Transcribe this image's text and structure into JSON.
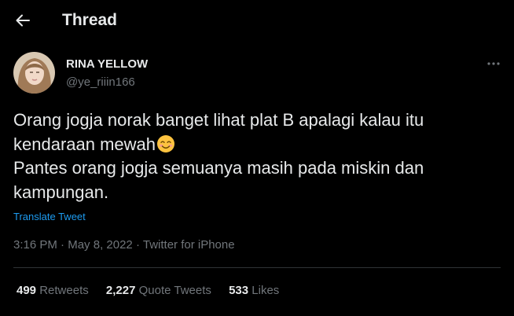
{
  "header": {
    "title": "Thread",
    "back_icon": "arrow-left-icon"
  },
  "tweet": {
    "author": {
      "display_name": "RINA YELLOW",
      "handle": "@ye_riiin166"
    },
    "more_icon": "more-horizontal-icon",
    "text_lines": [
      "Orang jogja norak banget lihat plat B apalagi kalau itu",
      "kendaraan mewah",
      "Pantes orang jogja semuanya masih pada miskin dan",
      "kampungan."
    ],
    "emoji_icon": "smiling-face-emoji",
    "translate_label": "Translate Tweet",
    "time": "3:16 PM",
    "date": "May 8, 2022",
    "source": "Twitter for iPhone",
    "separator": "·"
  },
  "stats": {
    "retweets": {
      "count": "499",
      "label": "Retweets"
    },
    "quote_tweets": {
      "count": "2,227",
      "label": "Quote Tweets"
    },
    "likes": {
      "count": "533",
      "label": "Likes"
    }
  },
  "colors": {
    "background": "#000000",
    "text_primary": "#e7e9ea",
    "text_secondary": "#71767b",
    "link": "#1d9bf0",
    "divider": "#2f3336"
  }
}
